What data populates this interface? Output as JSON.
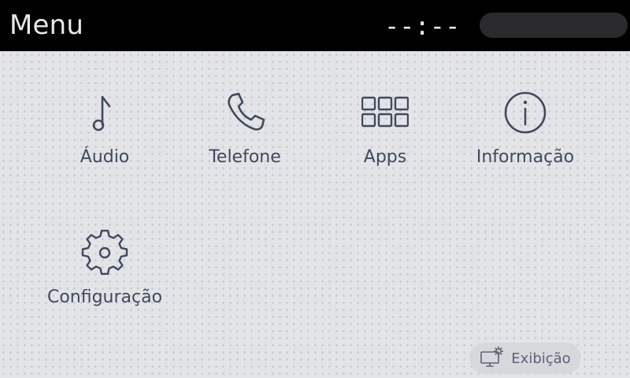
{
  "header": {
    "title": "Menu",
    "clock": "--:--"
  },
  "menu": {
    "items": [
      {
        "label": "Áudio",
        "icon": "music-note-icon"
      },
      {
        "label": "Telefone",
        "icon": "phone-icon"
      },
      {
        "label": "Apps",
        "icon": "apps-grid-icon"
      },
      {
        "label": "Informação",
        "icon": "info-icon"
      },
      {
        "label": "Configuração",
        "icon": "gear-icon"
      }
    ]
  },
  "footer": {
    "display_label": "Exibição",
    "display_icon": "display-settings-icon"
  },
  "colors": {
    "icon_stroke": "#3f4a5e",
    "header_bg": "#000000",
    "content_bg": "#e3e4e7"
  }
}
